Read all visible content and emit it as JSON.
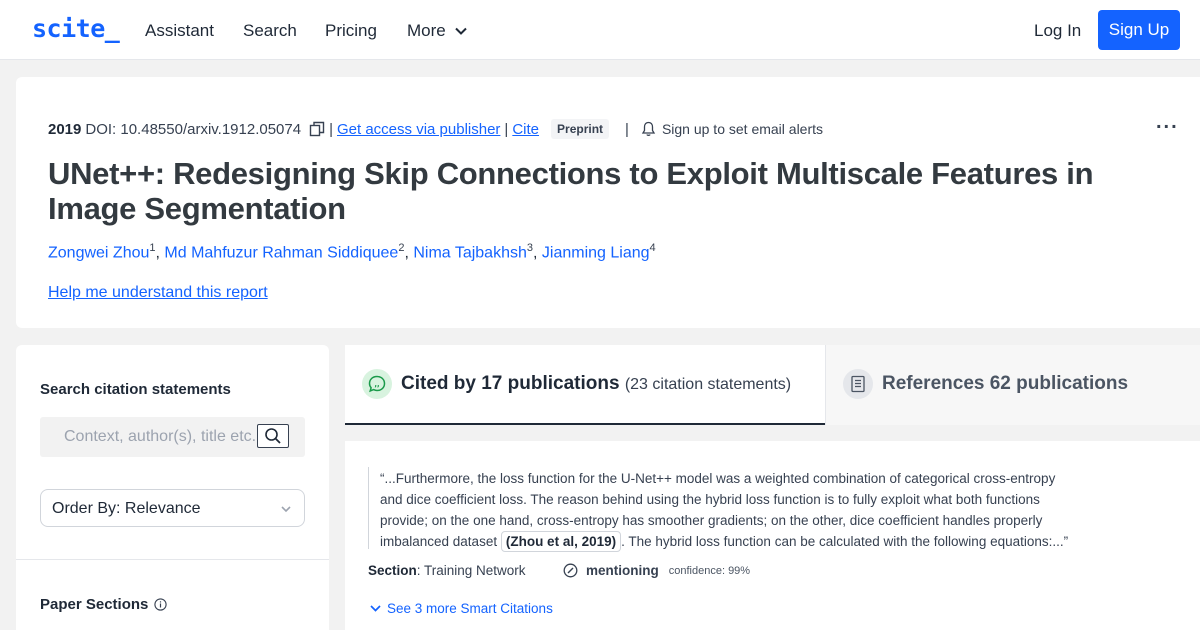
{
  "header": {
    "logo": "scite_",
    "nav": {
      "assistant": "Assistant",
      "search": "Search",
      "pricing": "Pricing",
      "more": "More"
    },
    "login": "Log In",
    "signup": "Sign Up"
  },
  "paper": {
    "year": "2019",
    "doi": "DOI: 10.48550/arxiv.1912.05074",
    "sep": "|",
    "access_link": "Get access via publisher",
    "cite_link": "Cite",
    "badge": "Preprint",
    "alerts": "Sign up to set email alerts",
    "more_menu": "...",
    "title": "UNet++: Redesigning Skip Connections to Exploit Multiscale Features in Image Segmentation",
    "authors": [
      {
        "name": "Zongwei Zhou",
        "sup": "1"
      },
      {
        "name": "Md Mahfuzur Rahman Siddiquee",
        "sup": "2"
      },
      {
        "name": "Nima Tajbakhsh",
        "sup": "3"
      },
      {
        "name": "Jianming Liang",
        "sup": "4"
      }
    ],
    "author_sep": ", ",
    "help_link": "Help me understand this report"
  },
  "sidebar": {
    "search_title": "Search citation statements",
    "search_placeholder": "Context, author(s), title etc.",
    "order_by": "Order By: Relevance",
    "sections_title": "Paper Sections"
  },
  "tabs": {
    "cited_by": "Cited by 17 publications",
    "cited_by_sub": "(23 citation statements)",
    "references": "References 62 publications"
  },
  "citation": {
    "line1": "“...Furthermore, the loss function for the U-Net++ model was a weighted combination of categorical cross-entropy",
    "line2": "and dice coefficient loss. The reason behind using the hybrid loss function is to fully exploit what both functions",
    "line3": "provide; on the one hand, cross-entropy has smoother gradients; on the other, dice coefficient handles properly",
    "line4_before": "imbalanced dataset ",
    "line4_chip": "(Zhou et al, 2019)",
    "line4_after": ". The hybrid loss function can be calculated with the following equations:...”",
    "section_label": "Section",
    "section_value": ": Training Network",
    "mention": "mentioning",
    "confidence": "confidence: 99%",
    "more_link": "See 3 more Smart Citations"
  },
  "colors": {
    "brand": "#1463ff",
    "tab_icon_bg": "#d8f3df",
    "tab_icon_fg": "#1a9a4a"
  }
}
